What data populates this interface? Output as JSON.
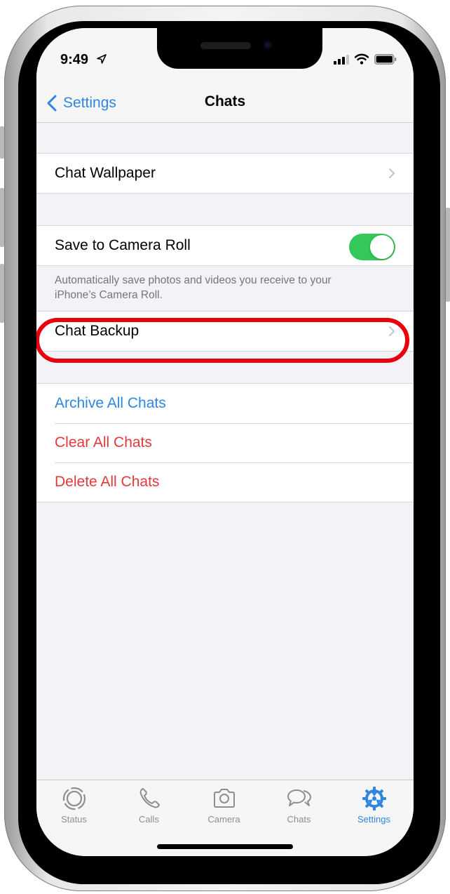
{
  "status_bar": {
    "time": "9:49",
    "icons": [
      "location-arrow-icon",
      "cellular-signal-icon",
      "wifi-icon",
      "battery-icon"
    ]
  },
  "nav": {
    "back_label": "Settings",
    "title": "Chats"
  },
  "sections": {
    "wallpaper": {
      "label": "Chat Wallpaper"
    },
    "camera_roll": {
      "label": "Save to Camera Roll",
      "toggle_on": true,
      "footer": "Automatically save photos and videos you receive to your iPhone’s Camera Roll."
    },
    "backup": {
      "label": "Chat Backup",
      "highlighted": true
    },
    "actions": [
      {
        "label": "Archive All Chats",
        "color": "#2f86e0"
      },
      {
        "label": "Clear All Chats",
        "color": "#e2393c"
      },
      {
        "label": "Delete All Chats",
        "color": "#e2393c"
      }
    ]
  },
  "tab_bar": {
    "active": "Settings",
    "tabs": [
      {
        "label": "Status",
        "icon": "status-icon"
      },
      {
        "label": "Calls",
        "icon": "phone-icon"
      },
      {
        "label": "Camera",
        "icon": "camera-icon"
      },
      {
        "label": "Chats",
        "icon": "chat-bubbles-icon"
      },
      {
        "label": "Settings",
        "icon": "gear-icon"
      }
    ]
  },
  "colors": {
    "accent": "#2f86e0",
    "destructive": "#e2393c",
    "toggle_on": "#34c759",
    "highlight": "#e8000b",
    "inactive_tab": "#8e8e93"
  }
}
